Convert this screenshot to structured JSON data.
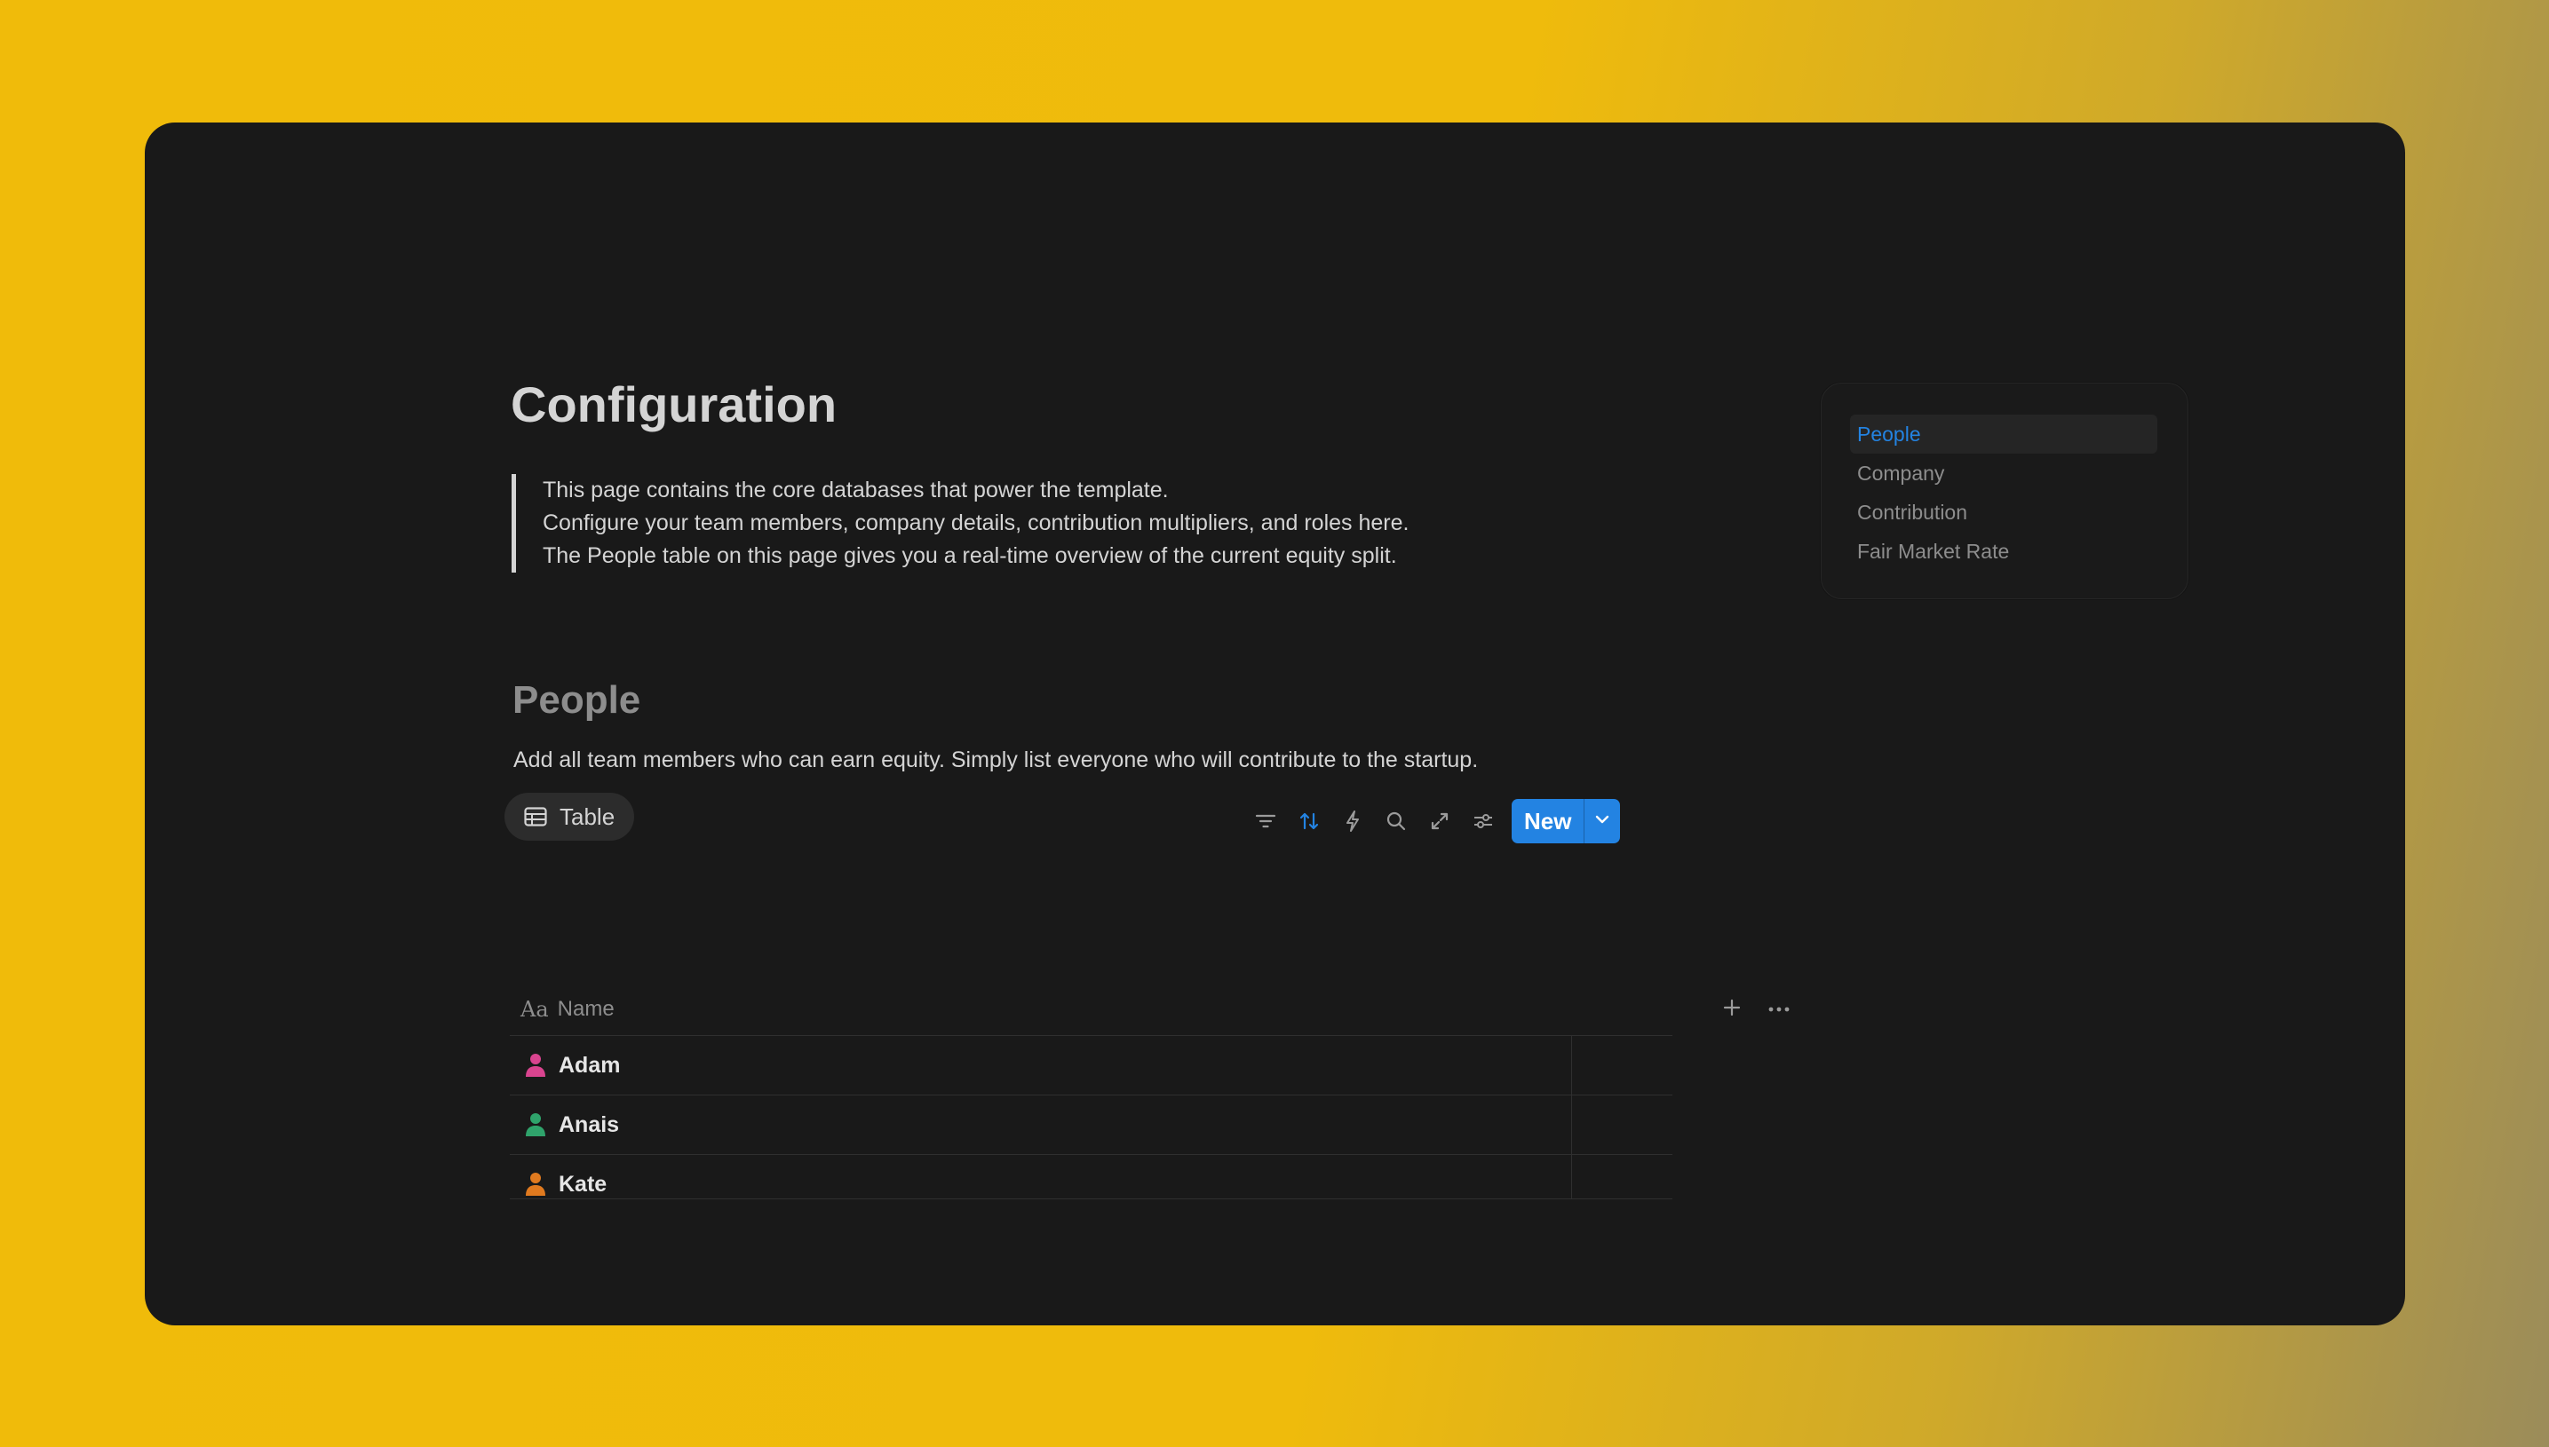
{
  "page": {
    "title": "Configuration",
    "callout_lines": [
      "This page contains the core databases that power the template.",
      "Configure your team members, company details, contribution multipliers, and roles here.",
      "The People table on this page gives you a real-time overview of the current equity split."
    ]
  },
  "people_section": {
    "title": "People",
    "description": "Add all team members who can earn equity. Simply list everyone who will contribute to the startup.",
    "view_tab": {
      "label": "Table",
      "icon": "table-icon"
    },
    "toolbar": {
      "icons": [
        "filter-icon",
        "sort-icon",
        "automation-icon",
        "search-icon",
        "expand-icon",
        "settings-icon"
      ],
      "sort_active_color": "#2383e2",
      "new_label": "New"
    },
    "table": {
      "name_column_icon_text": "Aa",
      "name_column_label": "Name",
      "rows": [
        {
          "name": "Adam",
          "icon": "person-icon",
          "color": "#d9448f"
        },
        {
          "name": "Anais",
          "icon": "person-icon",
          "color": "#2fa36b"
        },
        {
          "name": "Kate",
          "icon": "person-icon",
          "color": "#e07a1f"
        }
      ]
    }
  },
  "toc": {
    "items": [
      "People",
      "Company",
      "Contribution",
      "Fair Market Rate"
    ],
    "active": "People"
  },
  "colors": {
    "accent": "#2383e2",
    "background": "#191919",
    "text": "#d4d4d4"
  }
}
